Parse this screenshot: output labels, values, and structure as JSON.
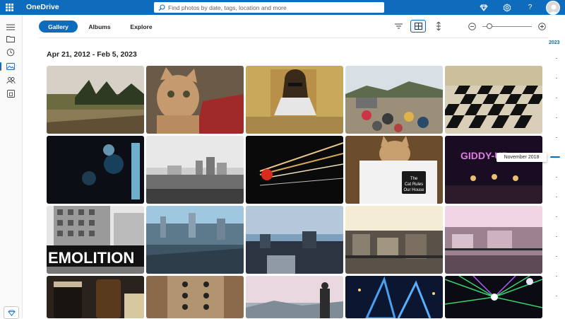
{
  "app": {
    "name": "OneDrive",
    "brand_color": "#0f6cbd",
    "search_placeholder": "Find photos by date, tags, location and more",
    "top_icons": [
      "premium-diamond-icon",
      "settings-gear-icon",
      "help-icon",
      "account-avatar"
    ],
    "help_label": "?"
  },
  "rail": {
    "items": [
      "menu-icon",
      "my-files-icon",
      "recent-icon",
      "photos-icon",
      "shared-icon",
      "recycle-bin-icon"
    ],
    "active": "photos-icon"
  },
  "toolbar": {
    "tabs": [
      {
        "label": "Gallery",
        "active": true
      },
      {
        "label": "Albums",
        "active": false
      },
      {
        "label": "Explore",
        "active": false
      }
    ],
    "tools": [
      "filter-icon",
      "grid-view-icon",
      "vertical-compact-icon",
      "zoom-out-icon",
      "zoom-slider",
      "zoom-in-icon"
    ],
    "selected_tool": "grid-view-icon",
    "zoom_level": 0.1
  },
  "gallery": {
    "date_range": "Apr 21, 2012 - Feb 5, 2023",
    "photos": [
      {
        "row": 1,
        "desc": "field-with-trees"
      },
      {
        "row": 1,
        "desc": "cat-selfie"
      },
      {
        "row": 1,
        "desc": "woman-with-sunglasses"
      },
      {
        "row": 1,
        "desc": "festival-crowd-mountains"
      },
      {
        "row": 1,
        "desc": "checkered-floor"
      },
      {
        "row": 2,
        "desc": "dark-bokeh-lights"
      },
      {
        "row": 2,
        "desc": "city-waterfront-bw"
      },
      {
        "row": 2,
        "desc": "light-trails-night"
      },
      {
        "row": 2,
        "desc": "cat-behind-sign",
        "sign_text": "The Cat Rules Our House"
      },
      {
        "row": 2,
        "desc": "neon-sign-bar",
        "neon_text": "GIDDY-UP"
      },
      {
        "row": 3,
        "desc": "demolition-building",
        "banner_text": "EMOLITION"
      },
      {
        "row": 3,
        "desc": "city-skyline-day"
      },
      {
        "row": 3,
        "desc": "city-dusk"
      },
      {
        "row": 3,
        "desc": "rooftops-view"
      },
      {
        "row": 3,
        "desc": "snowy-rooftops"
      },
      {
        "row": 4,
        "desc": "beer-glasses"
      },
      {
        "row": 4,
        "desc": "elevator-buttons"
      },
      {
        "row": 4,
        "desc": "person-at-overlook"
      },
      {
        "row": 4,
        "desc": "bridge-night-blue"
      },
      {
        "row": 4,
        "desc": "laser-show-concert"
      }
    ]
  },
  "timeline": {
    "year": "2023",
    "tooltip": "November 2018"
  }
}
